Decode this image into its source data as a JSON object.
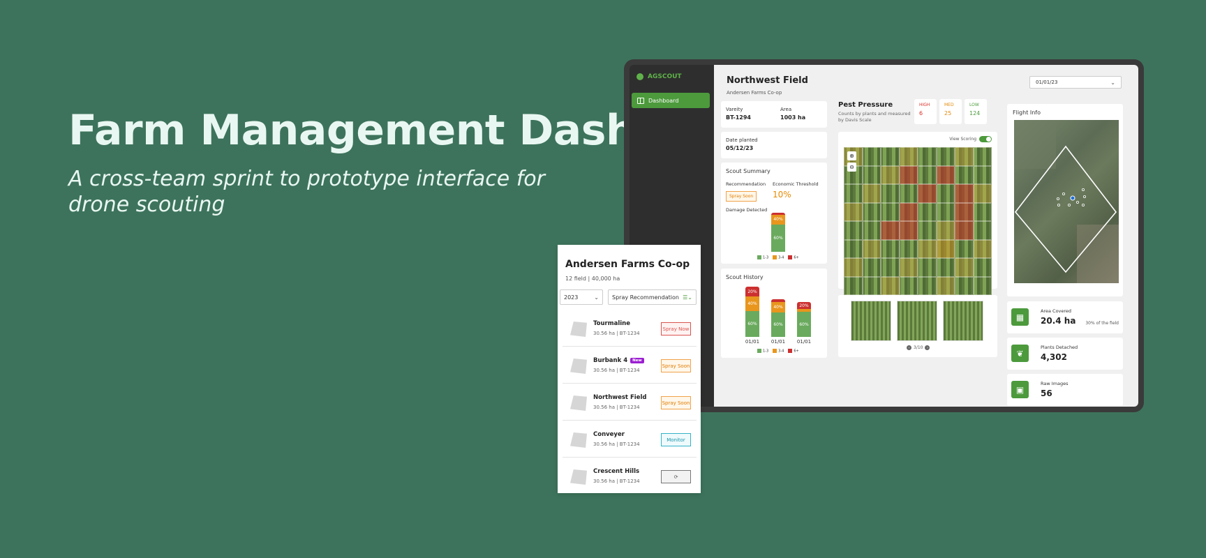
{
  "hero": {
    "title": "Farm Management Dashboard",
    "subtitle": "A cross-team sprint to prototype interface for drone scouting"
  },
  "app": {
    "brand": "AGSCOUT",
    "nav": [
      {
        "label": "Dashboard",
        "active": true,
        "icon": "dashboard-icon"
      }
    ],
    "field_title": "Northwest Field",
    "field_sub": "Andersen Farms Co-op",
    "date_value": "01/01/23"
  },
  "info": {
    "variety_label": "Vareity",
    "variety_value": "BT-1294",
    "area_label": "Area",
    "area_value": "1003 ha",
    "planted_label": "Date planted",
    "planted_value": "05/12/23"
  },
  "scout_summary": {
    "title": "Scout Summary",
    "rec_label": "Recommendation",
    "rec_value": "Spray Soon",
    "threshold_label": "Economic Threshold",
    "threshold_value": "10%",
    "damage_label": "Damage Detected",
    "stack": [
      {
        "label": "",
        "pct": 5
      },
      {
        "label": "40%",
        "pct": 25
      },
      {
        "label": "60%",
        "pct": 70
      }
    ]
  },
  "legend": [
    "1-3",
    "3-4",
    "6+"
  ],
  "scout_history": {
    "title": "Scout History",
    "bars": [
      {
        "x": "01/01",
        "red": "20%",
        "orange": "40%",
        "green": "60%"
      },
      {
        "x": "01/01",
        "red": "",
        "orange": "40%",
        "green": "60%"
      },
      {
        "x": "01/01",
        "red": "20%",
        "orange": "",
        "green": "60%"
      }
    ]
  },
  "pest": {
    "title": "Pest Pressure",
    "sub": "Counts by plants and measured by Davis Scale",
    "view_scoring": "View Scoring",
    "risk": [
      {
        "label": "HIGH",
        "value": "6",
        "color": "#d9302a"
      },
      {
        "label": "MED",
        "value": "25",
        "color": "#e08a0c"
      },
      {
        "label": "LOW",
        "value": "124",
        "color": "#4c9a3c"
      }
    ],
    "pager": "3/10"
  },
  "flight": {
    "title": "Flight Info"
  },
  "stats": [
    {
      "label": "Area Covered",
      "value": "20.4 ha",
      "note": "30% of the field",
      "icon": "grid-icon"
    },
    {
      "label": "Plants Detached",
      "value": "4,302",
      "note": "",
      "icon": "plant-icon"
    },
    {
      "label": "Raw Images",
      "value": "56",
      "note": "",
      "icon": "image-icon"
    }
  ],
  "mobile": {
    "title": "Andersen Farms Co-op",
    "sub": "12 field | 40,000 ha",
    "year_select": "2023",
    "filter_select": "Spray Recommendation",
    "rows": [
      {
        "name": "Tourmaline",
        "meta": "30.56 ha | BT-1234",
        "action": "Spray Now",
        "type": "now",
        "badge": ""
      },
      {
        "name": "Burbank 4",
        "meta": "30.56 ha | BT-1234",
        "action": "Spray Soon",
        "type": "soon",
        "badge": "New"
      },
      {
        "name": "Northwest Field",
        "meta": "30.56 ha | BT-1234",
        "action": "Spray Soon",
        "type": "soon",
        "badge": ""
      },
      {
        "name": "Conveyer",
        "meta": "30.56 ha | BT-1234",
        "action": "Monitor",
        "type": "monitor",
        "badge": ""
      },
      {
        "name": "Crescent Hills",
        "meta": "30.56 ha | BT-1234",
        "action": "",
        "type": "refresh",
        "badge": ""
      }
    ]
  },
  "colors": {
    "background": "#3d735c",
    "accent": "#4c9a3c"
  }
}
